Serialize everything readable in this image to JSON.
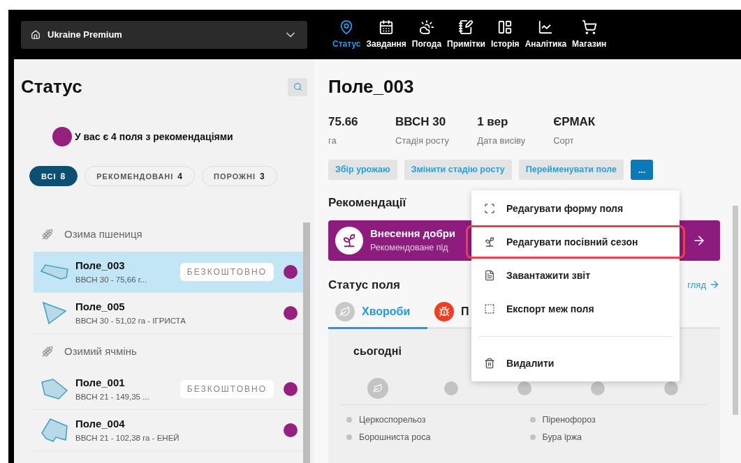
{
  "account": {
    "name": "Ukraine Premium"
  },
  "nav": [
    {
      "label": "Статус",
      "selected": true
    },
    {
      "label": "Завдання",
      "selected": false
    },
    {
      "label": "Погода",
      "selected": false
    },
    {
      "label": "Примітки",
      "selected": false
    },
    {
      "label": "Історія",
      "selected": false
    },
    {
      "label": "Аналітика",
      "selected": false
    },
    {
      "label": "Магазин",
      "selected": false
    }
  ],
  "sidebar": {
    "title": "Статус",
    "notice": {
      "text": "У вас є 4 поля з рекомендаціями",
      "color": "#962080"
    },
    "filters": [
      {
        "label": "ВСІ",
        "count": "8",
        "selected": true
      },
      {
        "label": "РЕКОМЕНДОВАНІ",
        "count": "4",
        "selected": false
      },
      {
        "label": "ПОРОЖНІ",
        "count": "3",
        "selected": false
      }
    ],
    "groups": [
      {
        "crop": "Озима пшениця",
        "fields": [
          {
            "name": "Поле_003",
            "details": "ВВСН 30 - 75,66 г...",
            "badge": "БЕЗКОШТОВНО",
            "color": "#962080",
            "selected": true
          },
          {
            "name": "Поле_005",
            "details": "ВВСН 30 - 51,02 га - ІГРИСТА",
            "color": "#962080",
            "selected": false
          }
        ]
      },
      {
        "crop": "Озимий ячмінь",
        "fields": [
          {
            "name": "Поле_001",
            "details": "ВВСН 21 - 149,35 ...",
            "badge": "БЕЗКОШТОВНО",
            "color": "#962080",
            "selected": false
          },
          {
            "name": "Поле_004",
            "details": "ВВСН 21 - 102,38 га - ЕНЕЙ",
            "color": "#962080",
            "selected": false
          }
        ]
      }
    ]
  },
  "field": {
    "title": "Поле_003",
    "stats": [
      {
        "value": "75.66",
        "label": "га"
      },
      {
        "value": "ВВСН 30",
        "label": "Стадія росту"
      },
      {
        "value": "1 вер",
        "label": "Дата висіву"
      },
      {
        "value": "ЄРМАК",
        "label": "Сорт"
      }
    ],
    "actions": [
      "Збір урожаю",
      "Змінити стадію росту",
      "Перейменувати поле"
    ],
    "more_button": "...",
    "recommendations": {
      "heading": "Рекомендації",
      "card": {
        "title": "Внесення добри",
        "subtitle": "Рекомендоване під"
      }
    },
    "status": {
      "heading": "Статус поля",
      "link": "гляд",
      "tabs": [
        {
          "label": "Хвороби",
          "selected": true
        },
        {
          "label": "П",
          "selected": false
        }
      ],
      "days": [
        {
          "label": "сьогодні",
          "selected": true
        },
        {
          "selected": false
        },
        {
          "selected": false
        },
        {
          "selected": false
        },
        {
          "selected": false
        }
      ],
      "diseases": [
        "Церкоспорельоз",
        "Піренофороз",
        "Борошниста роса",
        "Бура іржа"
      ]
    }
  },
  "menu": [
    {
      "kind": "item",
      "label": "Редагувати форму поля",
      "highlighted": false
    },
    {
      "kind": "item",
      "label": "Редагувати посівний сезон",
      "highlighted": true
    },
    {
      "kind": "item",
      "label": "Завантажити звіт",
      "highlighted": false
    },
    {
      "kind": "item",
      "label": "Експорт меж поля",
      "highlighted": false
    },
    {
      "kind": "divider"
    },
    {
      "kind": "item",
      "label": "Видалити",
      "highlighted": false
    }
  ]
}
